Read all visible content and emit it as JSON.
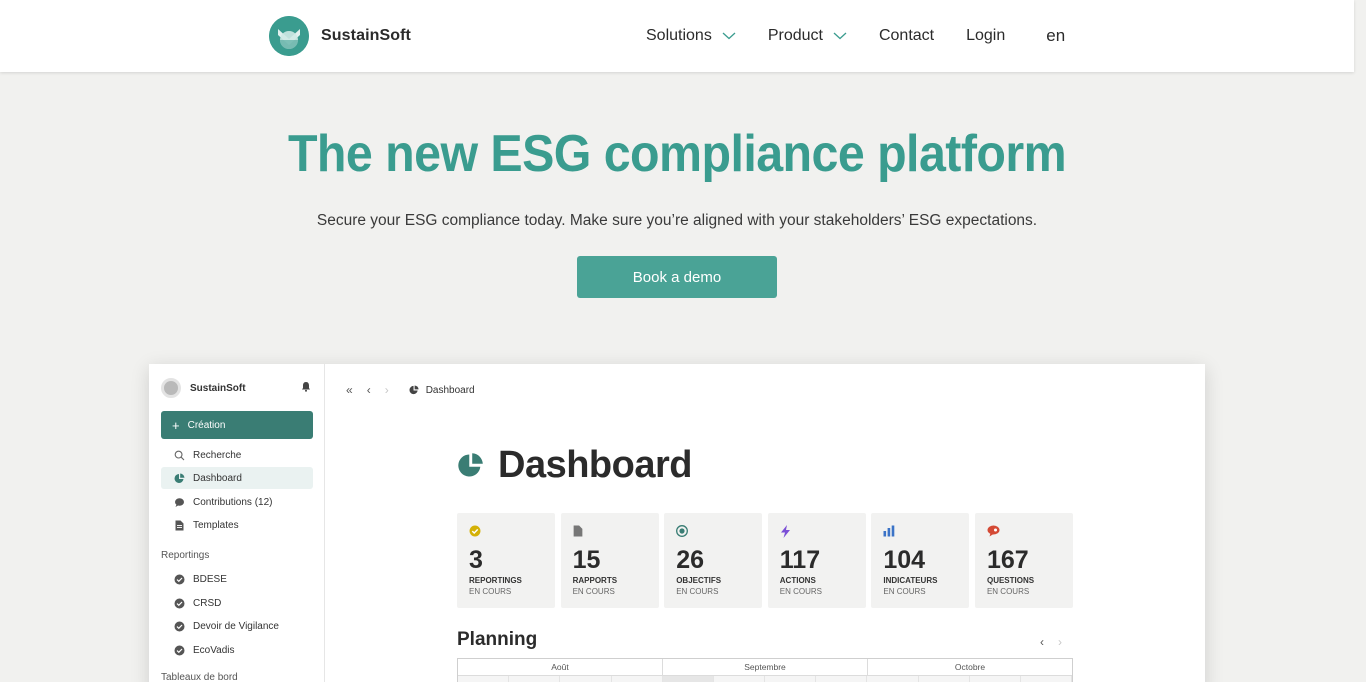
{
  "nav": {
    "brand": "SustainSoft",
    "links": [
      {
        "label": "Solutions",
        "dropdown": true
      },
      {
        "label": "Product",
        "dropdown": true
      },
      {
        "label": "Contact",
        "dropdown": false
      },
      {
        "label": "Login",
        "dropdown": false
      }
    ],
    "language": "en"
  },
  "hero": {
    "title": "The new ESG compliance platform",
    "subtitle": "Secure your ESG compliance today. Make sure you’re aligned with your stakeholders’ ESG expectations.",
    "cta_label": "Book a demo"
  },
  "colors": {
    "accent": "#3a9c8f",
    "button": "#4aa396",
    "sidebar_create": "#3a7d74"
  },
  "app": {
    "sidebar": {
      "workspace": "SustainSoft",
      "create_label": "Création",
      "items": [
        {
          "label": "Recherche",
          "icon": "search-icon"
        },
        {
          "label": "Dashboard",
          "icon": "pie-chart-icon",
          "active": true
        },
        {
          "label": "Contributions (12)",
          "icon": "chat-icon"
        },
        {
          "label": "Templates",
          "icon": "document-icon"
        }
      ],
      "reportings_heading": "Reportings",
      "reportings": [
        {
          "label": "BDESE"
        },
        {
          "label": "CRSD"
        },
        {
          "label": "Devoir de Vigilance"
        },
        {
          "label": "EcoVadis"
        }
      ],
      "dashboards_heading": "Tableaux de bord"
    },
    "breadcrumb": "Dashboard",
    "page_title": "Dashboard",
    "cards": [
      {
        "value": "3",
        "label": "REPORTINGS",
        "sub": "EN COURS",
        "icon": "check-circle-icon",
        "color": "#d4b106"
      },
      {
        "value": "15",
        "label": "RAPPORTS",
        "sub": "EN COURS",
        "icon": "file-icon",
        "color": "#777777"
      },
      {
        "value": "26",
        "label": "OBJECTIFS",
        "sub": "EN COURS",
        "icon": "target-icon",
        "color": "#3a7d74"
      },
      {
        "value": "117",
        "label": "ACTIONS",
        "sub": "EN COURS",
        "icon": "lightning-icon",
        "color": "#7b4fd6"
      },
      {
        "value": "104",
        "label": "INDICATEURS",
        "sub": "EN COURS",
        "icon": "bar-chart-icon",
        "color": "#3b73c7"
      },
      {
        "value": "167",
        "label": "QUESTIONS",
        "sub": "EN COURS",
        "icon": "question-bubble-icon",
        "color": "#d44a35"
      }
    ],
    "planning": {
      "title": "Planning",
      "months": [
        "Août",
        "Septembre",
        "Octobre"
      ]
    }
  }
}
